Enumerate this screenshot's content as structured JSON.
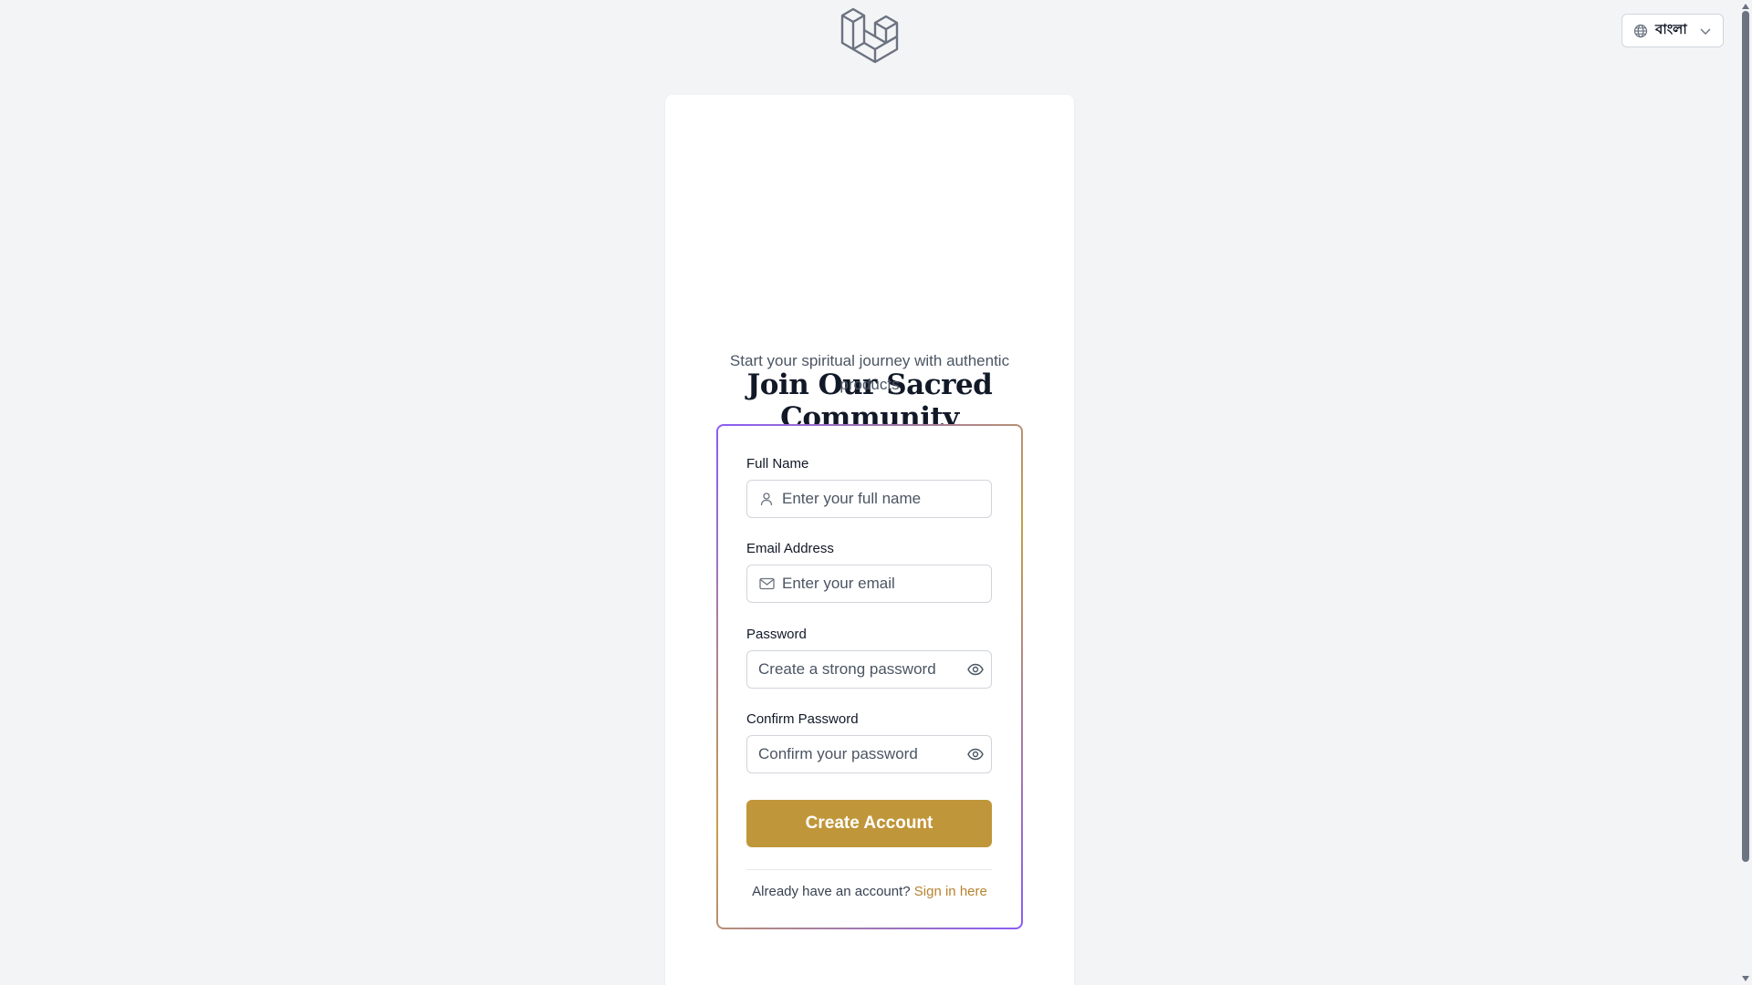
{
  "header": {
    "logo_icon": "laravel-logo-icon",
    "language": {
      "icon": "globe-icon",
      "selected": "বাংলা",
      "chevron_icon": "chevron-down-icon"
    }
  },
  "form": {
    "title_line1": "Join Our Sacred",
    "title_line2": "Community",
    "subtitle": "Start your spiritual journey with authentic products",
    "full_name": {
      "label": "Full Name",
      "placeholder": "Enter your full name",
      "icon": "user-icon"
    },
    "email": {
      "label": "Email Address",
      "placeholder": "Enter your email",
      "icon": "mail-icon"
    },
    "password": {
      "label": "Password",
      "placeholder": "Create a strong password",
      "toggle_icon": "eye-icon"
    },
    "confirm_password": {
      "label": "Confirm Password",
      "placeholder": "Confirm your password",
      "toggle_icon": "eye-icon"
    },
    "submit_label": "Create Account",
    "signin_prompt": "Already have an account?",
    "signin_link": "Sign in here"
  },
  "colors": {
    "accent": "#c0963a",
    "link": "#b7832f",
    "border_gradient_start": "#8b5cf6",
    "border_gradient_mid": "#c4a04a",
    "background": "#f3f4f6"
  }
}
